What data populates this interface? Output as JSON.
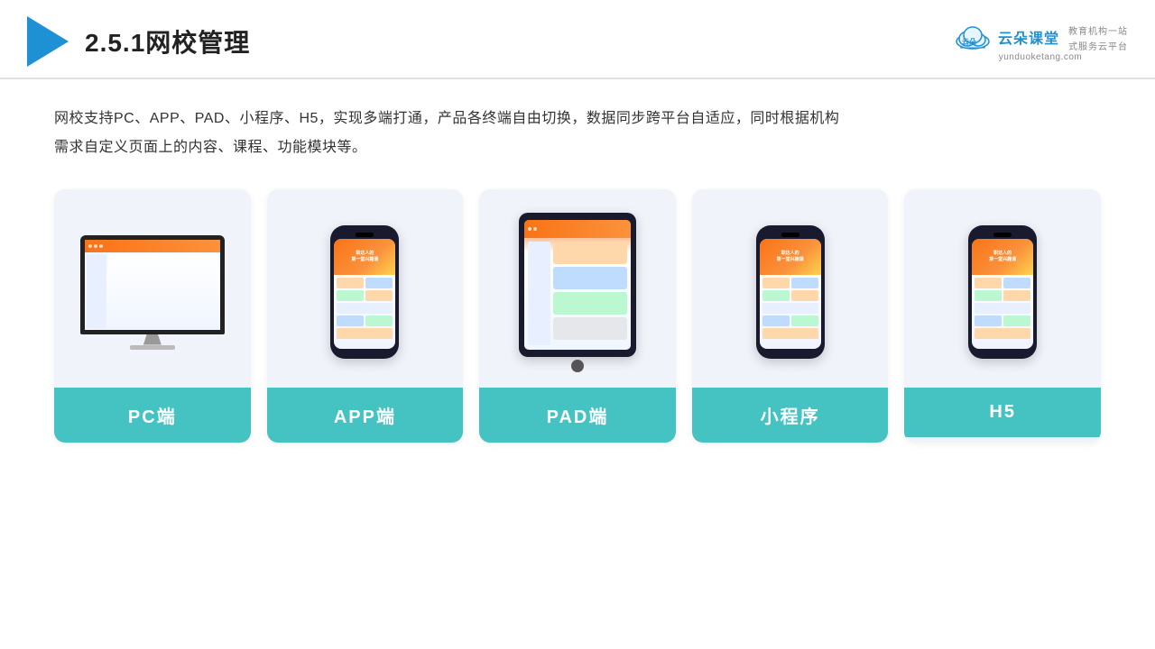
{
  "header": {
    "title": "2.5.1网校管理",
    "brand": {
      "name": "云朵课堂",
      "url": "yunduoketang.com",
      "slogan": "教育机构一站\n式服务云平台"
    }
  },
  "main": {
    "description": "网校支持PC、APP、PAD、小程序、H5，实现多端打通，产品各终端自由切换，数据同步跨平台自适应，同时根据机构\n需求自定义页面上的内容、课程、功能模块等。",
    "cards": [
      {
        "id": "pc",
        "label": "PC端"
      },
      {
        "id": "app",
        "label": "APP端"
      },
      {
        "id": "pad",
        "label": "PAD端"
      },
      {
        "id": "miniprogram",
        "label": "小程序"
      },
      {
        "id": "h5",
        "label": "H5"
      }
    ]
  },
  "colors": {
    "accent": "#45c3c3",
    "header_border": "#e0e0e0",
    "brand_blue": "#1e90d4",
    "card_bg": "#f0f4fa"
  }
}
